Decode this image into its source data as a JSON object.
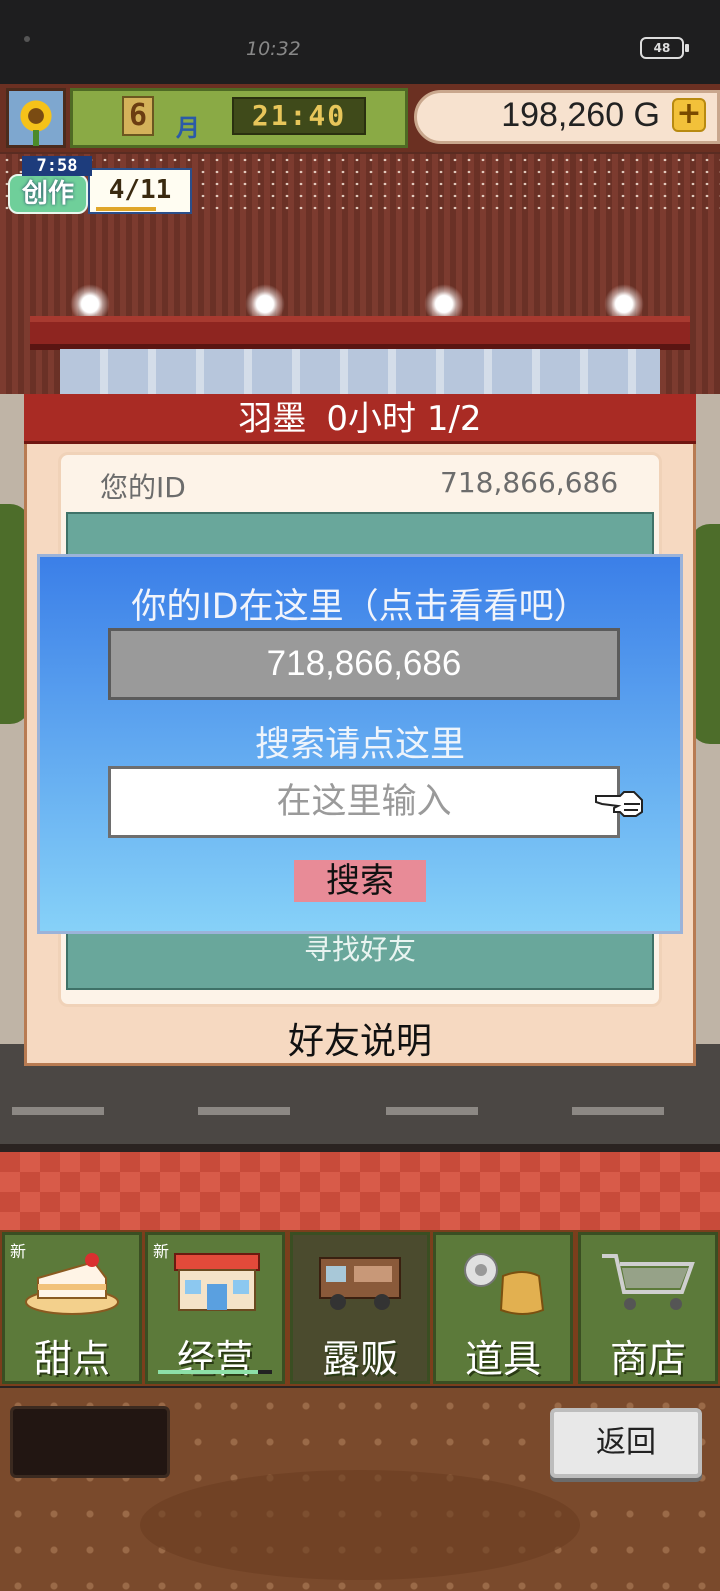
{
  "status_bar": {
    "time": "10:32",
    "battery": "48"
  },
  "hud": {
    "month": "6",
    "month_label": "月",
    "clock": "21:40",
    "money": "198,260 G",
    "add_money_icon": "plus-icon"
  },
  "craft": {
    "timer": "7:58",
    "label": "创作",
    "progress": "4/11"
  },
  "friend_dialog": {
    "title_name": "羽墨",
    "title_info": "0小时 1/2",
    "id_label": "您的ID",
    "id_value": "718,866,686",
    "find_friends": "寻找好友",
    "help": "好友说明"
  },
  "id_overlay": {
    "title": "你的ID在这里（点击看看吧）",
    "id_value": "718,866,686",
    "search_hint": "搜索请点这里",
    "input_placeholder": "在这里输入",
    "search_button": "搜索",
    "pointer_icon": "hand-pointer-icon"
  },
  "tabs": [
    {
      "label": "甜点",
      "new": "新",
      "icon": "cake-icon"
    },
    {
      "label": "经营",
      "new": "新",
      "icon": "shop-icon"
    },
    {
      "label": "露贩",
      "new": "",
      "icon": "food-truck-icon"
    },
    {
      "label": "道具",
      "new": "",
      "icon": "item-bag-icon"
    },
    {
      "label": "商店",
      "new": "",
      "icon": "shopping-cart-icon"
    }
  ],
  "bottom": {
    "back_button": "返回"
  },
  "colors": {
    "dialog_header": "#a92b24",
    "overlay_top": "#3b7fe8",
    "overlay_bottom": "#86d1f8",
    "search_button": "#e88b97",
    "tab_green": "#5c7a3a"
  }
}
